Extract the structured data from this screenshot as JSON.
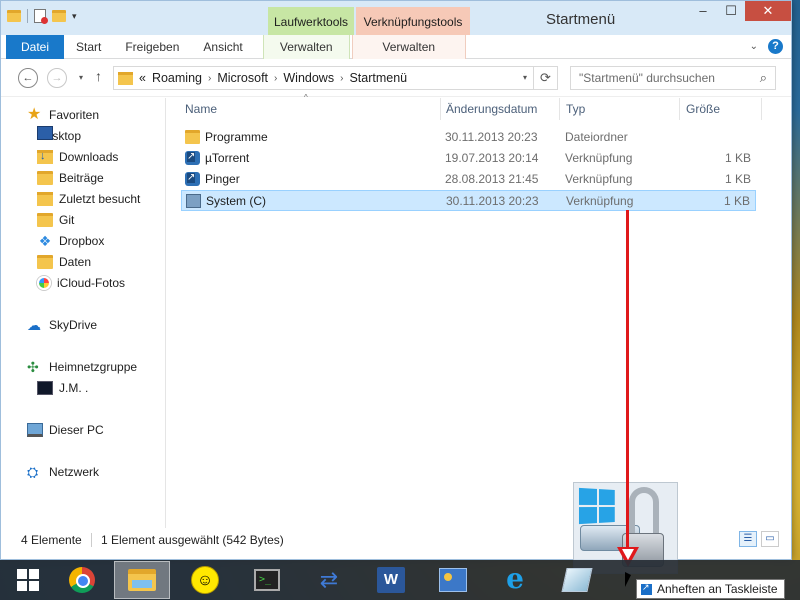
{
  "window": {
    "title": "Startmenü",
    "context_tabs": [
      "Laufwerktools",
      "Verknüpfungstools"
    ],
    "controls": {
      "minimize": "–",
      "maximize": "☐",
      "close": "✕"
    }
  },
  "ribbon": {
    "tabs": [
      "Datei",
      "Start",
      "Freigeben",
      "Ansicht",
      "Verwalten",
      "Verwalten"
    ],
    "help": "?"
  },
  "address": {
    "path": [
      "«",
      "Roaming",
      "Microsoft",
      "Windows",
      "Startmenü"
    ],
    "search_placeholder": "\"Startmenü\" durchsuchen"
  },
  "sidebar": {
    "favorites_label": "Favoriten",
    "favorites": [
      "Desktop",
      "Downloads",
      "Beiträge",
      "Zuletzt besucht",
      "Git",
      "Dropbox",
      "Daten",
      "iCloud-Fotos"
    ],
    "skydrive": "SkyDrive",
    "homegroup": "Heimnetzgruppe",
    "homegroup_user": "J.M. .",
    "this_pc": "Dieser PC",
    "network": "Netzwerk"
  },
  "file_list": {
    "columns": [
      "Name",
      "Änderungsdatum",
      "Typ",
      "Größe"
    ],
    "rows": [
      {
        "name": "Programme",
        "date": "30.11.2013 20:23",
        "type": "Dateiordner",
        "size": "",
        "icon": "folder-icon"
      },
      {
        "name": "µTorrent",
        "date": "19.07.2013 20:14",
        "type": "Verknüpfung",
        "size": "1 KB",
        "icon": "shortcut-icon"
      },
      {
        "name": "Pinger",
        "date": "28.08.2013 21:45",
        "type": "Verknüpfung",
        "size": "1 KB",
        "icon": "shortcut-icon"
      },
      {
        "name": "System (C)",
        "date": "30.11.2013 20:23",
        "type": "Verknüpfung",
        "size": "1 KB",
        "icon": "drive-shortcut-icon",
        "selected": true
      }
    ]
  },
  "status": {
    "count": "4 Elemente",
    "selection": "1 Element ausgewählt (542 Bytes)"
  },
  "taskbar": {
    "apps": [
      "start-icon",
      "chrome-icon",
      "file-explorer-icon",
      "smiley-icon",
      "terminal-icon",
      "network-icon",
      "word-icon",
      "control-panel-icon",
      "internet-explorer-icon",
      "glass-icon"
    ],
    "tooltip": "Anheften an Taskleiste"
  },
  "colors": {
    "accent": "#1979ca",
    "selection": "#cce8ff",
    "drag_arrow": "#e0181b",
    "close_button": "#c74f41"
  }
}
